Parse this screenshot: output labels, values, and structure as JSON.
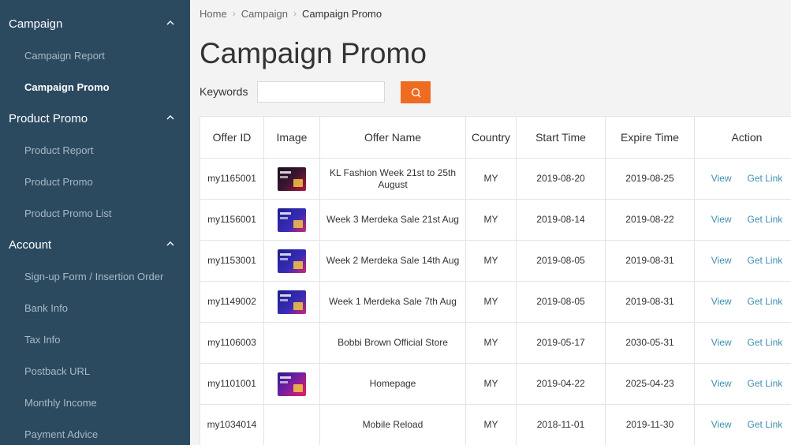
{
  "sidebar": {
    "sections": [
      {
        "label": "Campaign",
        "items": [
          {
            "label": "Campaign Report"
          },
          {
            "label": "Campaign Promo"
          }
        ]
      },
      {
        "label": "Product Promo",
        "items": [
          {
            "label": "Product Report"
          },
          {
            "label": "Product Promo"
          },
          {
            "label": "Product Promo List"
          }
        ]
      },
      {
        "label": "Account",
        "items": [
          {
            "label": "Sign-up Form / Insertion Order"
          },
          {
            "label": "Bank Info"
          },
          {
            "label": "Tax Info"
          },
          {
            "label": "Postback URL"
          },
          {
            "label": "Monthly Income"
          },
          {
            "label": "Payment Advice"
          }
        ]
      }
    ],
    "active_item": "Campaign Promo"
  },
  "breadcrumb": [
    "Home",
    "Campaign",
    "Campaign Promo"
  ],
  "page_title": "Campaign Promo",
  "search": {
    "label": "Keywords",
    "value": "",
    "placeholder": ""
  },
  "table": {
    "headers": {
      "offer_id": "Offer ID",
      "image": "Image",
      "offer_name": "Offer Name",
      "country": "Country",
      "start_time": "Start Time",
      "expire_time": "Expire Time",
      "action": "Action"
    },
    "action_labels": {
      "view": "View",
      "get_link": "Get Link"
    },
    "rows": [
      {
        "offer_id": "my1165001",
        "image": "fashion",
        "offer_name": "KL Fashion Week 21st to 25th August",
        "country": "MY",
        "start_time": "2019-08-20",
        "expire_time": "2019-08-25"
      },
      {
        "offer_id": "my1156001",
        "image": "merdeka",
        "offer_name": "Week 3 Merdeka Sale 21st Aug",
        "country": "MY",
        "start_time": "2019-08-14",
        "expire_time": "2019-08-22"
      },
      {
        "offer_id": "my1153001",
        "image": "merdeka",
        "offer_name": "Week 2 Merdeka Sale 14th Aug",
        "country": "MY",
        "start_time": "2019-08-05",
        "expire_time": "2019-08-31"
      },
      {
        "offer_id": "my1149002",
        "image": "merdeka",
        "offer_name": "Week 1 Merdeka Sale 7th Aug",
        "country": "MY",
        "start_time": "2019-08-05",
        "expire_time": "2019-08-31"
      },
      {
        "offer_id": "my1106003",
        "image": "",
        "offer_name": "Bobbi Brown Official Store",
        "country": "MY",
        "start_time": "2019-05-17",
        "expire_time": "2030-05-31"
      },
      {
        "offer_id": "my1101001",
        "image": "homepage",
        "offer_name": "Homepage",
        "country": "MY",
        "start_time": "2019-04-22",
        "expire_time": "2025-04-23"
      },
      {
        "offer_id": "my1034014",
        "image": "",
        "offer_name": "Mobile Reload",
        "country": "MY",
        "start_time": "2018-11-01",
        "expire_time": "2019-11-30"
      }
    ]
  },
  "colors": {
    "sidebar_bg": "#2b4a60",
    "accent": "#f06b22",
    "link": "#3d8fb0"
  },
  "icons": {
    "search": "search-icon",
    "collapse": "chevron-up-icon",
    "breadcrumb_sep": "chevron-right-icon"
  }
}
